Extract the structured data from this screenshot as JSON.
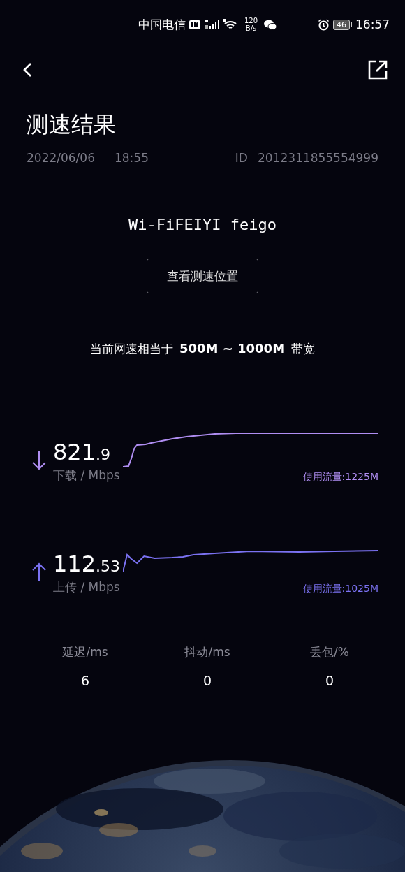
{
  "status_bar": {
    "carrier": "中国电信",
    "network_speed": "120",
    "network_speed_unit": "B/s",
    "battery": "46",
    "time": "16:57"
  },
  "title": "测速结果",
  "meta": {
    "date": "2022/06/06",
    "time": "18:55",
    "id_label": "ID",
    "id_value": "2012311855554999"
  },
  "network_name": "Wi-FiFEIYI_feigo",
  "location_button": "查看测速位置",
  "bandwidth_note": "当前网速相当于 **500M ~ 1000M** 带宽",
  "speeds": [
    {
      "kind": "download",
      "value_int": "821",
      "value_dec": ".9",
      "label": "下载 / Mbps",
      "usage": "使用流量:1225M",
      "color": "#b08ef2"
    },
    {
      "kind": "upload",
      "value_int": "112",
      "value_dec": ".53",
      "label": "上传 / Mbps",
      "usage": "使用流量:1025M",
      "color": "#7b72f2"
    }
  ],
  "stats": [
    {
      "label": "延迟/ms",
      "value": "6"
    },
    {
      "label": "抖动/ms",
      "value": "0"
    },
    {
      "label": "丢包/%",
      "value": "0"
    }
  ]
}
